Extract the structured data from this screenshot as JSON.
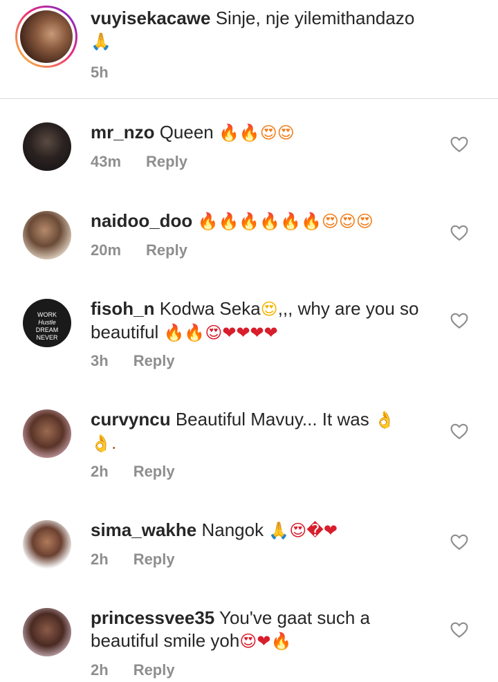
{
  "caption": {
    "username": "vuyisekacawe",
    "text": "Sinje, nje yilemithandazo",
    "emoji": "🙏",
    "time": "5h"
  },
  "reply_label": "Reply",
  "comments": [
    {
      "username": "mr_nzo",
      "text": "Queen",
      "emoji": "🔥🔥😍😍",
      "time": "43m"
    },
    {
      "username": "naidoo_doo",
      "text": "",
      "emoji": "🔥🔥🔥🔥🔥🔥😍😍😍",
      "time": "20m"
    },
    {
      "username": "fisoh_n",
      "text": "Kodwa Seka",
      "emoji_mid": "😍",
      "text2": ",,, why are you so beautiful",
      "emoji": "🔥🔥😍❤❤❤❤",
      "time": "3h"
    },
    {
      "username": "curvyncu",
      "text": "Beautiful Mavuy... It was",
      "emoji": "👌",
      "text2": "👌.",
      "time": "2h"
    },
    {
      "username": "sima_wakhe",
      "text": "Nangok",
      "emoji": "🙏😍�❤",
      "time": "2h"
    },
    {
      "username": "princessvee35",
      "text": "You've gaat such a beautiful smile yoh",
      "emoji": "😍❤🔥",
      "time": "2h"
    }
  ],
  "icons": {
    "like": "heart-outline-icon"
  },
  "colors": {
    "text": "#262626",
    "secondary": "#8e8e8e",
    "divider": "#dbdbdb"
  }
}
